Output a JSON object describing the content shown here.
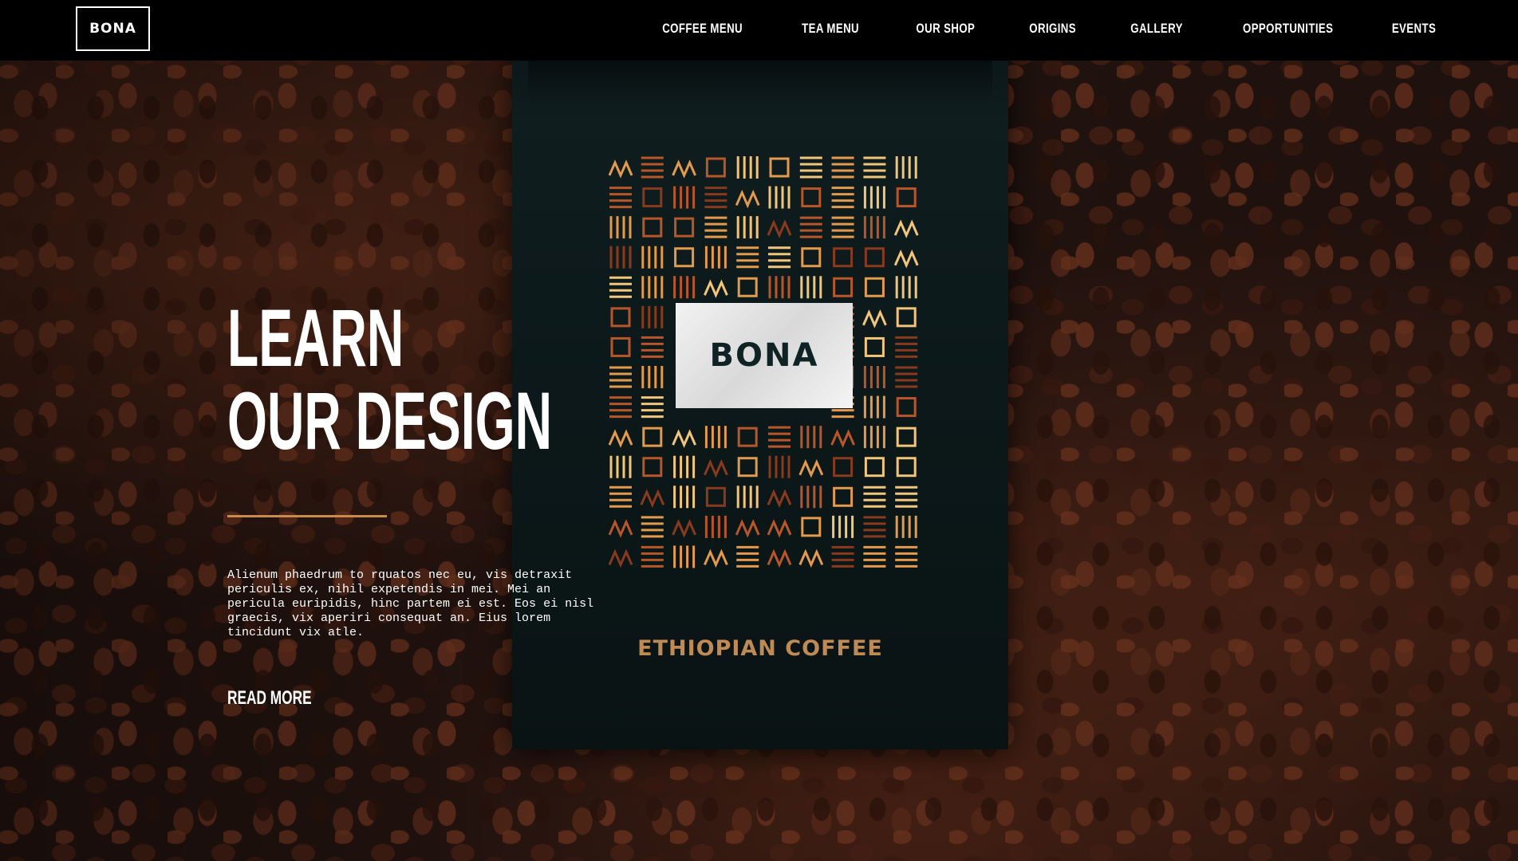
{
  "header": {
    "logo_text": "BONA",
    "nav": [
      {
        "label": "COFFEE MENU"
      },
      {
        "label": "TEA MENU"
      },
      {
        "label": "OUR SHOP"
      },
      {
        "label": "ORIGINS"
      },
      {
        "label": "GALLERY"
      },
      {
        "label": "OPPORTUNITIES"
      },
      {
        "label": "EVENTS"
      }
    ]
  },
  "hero": {
    "title_line1": "LEARN",
    "title_line2": "OUR DESIGN",
    "description": "Alienum phaedrum to rquatos nec eu, vis detraxit periculis ex, nihil expetendis in mei. Mei an pericula euripidis, hinc partem ei est. Eos ei nisl graecis, vix aperiri consequat an. Eius lorem tincidunt vix atle.",
    "read_more": "READ MORE",
    "accent_color": "#c98b4a"
  },
  "product": {
    "label_text": "BONA",
    "caption": "ETHIOPIAN COFFEE",
    "bag_color": "#0c1819",
    "pattern_colors": [
      "#b8562a",
      "#e39a4c",
      "#f2c67a",
      "#8a3a1c"
    ]
  }
}
